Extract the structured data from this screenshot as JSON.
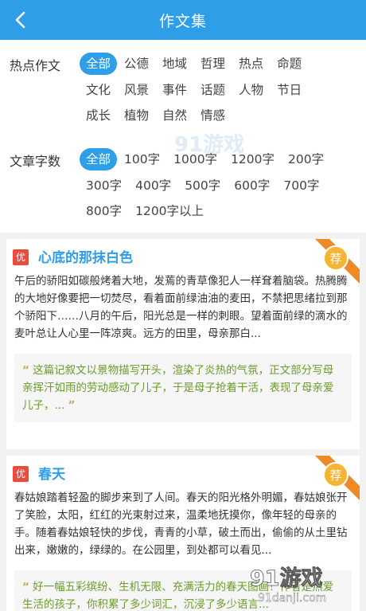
{
  "header": {
    "title": "作文集"
  },
  "filters": {
    "hot": {
      "label": "热点作文",
      "items": [
        "全部",
        "公德",
        "地域",
        "哲理",
        "热点",
        "命题",
        "文化",
        "风景",
        "事件",
        "话题",
        "人物",
        "节日",
        "成长",
        "植物",
        "自然",
        "情感"
      ]
    },
    "words": {
      "label": "文章字数",
      "items": [
        "全部",
        "100字",
        "1000字",
        "1200字",
        "200字",
        "300字",
        "400字",
        "500字",
        "600字",
        "700字",
        "800字",
        "1200字以上"
      ]
    }
  },
  "articles": [
    {
      "badge": "优",
      "title": "心底的那抹白色",
      "ribbon": "荐",
      "excerpt": "午后的骄阳如碳般烤着大地，发蔫的青草像犯人一样耷着脑袋。热腾腾的大地好像要把一切焚尽，看着面前绿油油的麦田，不禁把思绪拉到那个骄阳下……八月的午后，阳光总是一样的刺眼。望着面前绿的滴水的麦叶总让人心里一阵凉爽。远方的田里，母亲那白...",
      "comment": "这篇记叙文以景物描写开头，渲染了炎热的气氛，正文部分写母亲挥汗如雨的劳动感动了儿子，于是母子抢着干活，表现了母亲爱儿子，..."
    },
    {
      "badge": "优",
      "title": "春天",
      "ribbon": "荐",
      "excerpt": "春姑娘踏着轻盈的脚步来到了人间。春天的阳光格外明媚，春姑娘张开了笑脸，太阳，红红的光束射过来，温柔地抚摸你，像年轻的母亲的手。随着春姑娘轻快的步伐，青青的小草，破土而出，偷偷的从土里钻出来，嫩嫩的，绿绿的。在公园里，到处都可以看见...",
      "comment": "好一幅五彩缤纷、生机无限、充满活力的春天图画！作者是热爱生活的孩子，你积累了多少词汇，沉浸了多少语言..."
    }
  ],
  "watermark": {
    "brand": "91游戏",
    "site": "91danji.com",
    "mid": "91游戏"
  },
  "colors": {
    "primary": "#2f9ee9",
    "badge": "#e94b3c",
    "comment": "#6b9b28",
    "ribbon": "#f08a24",
    "medal": "#f5b431"
  }
}
